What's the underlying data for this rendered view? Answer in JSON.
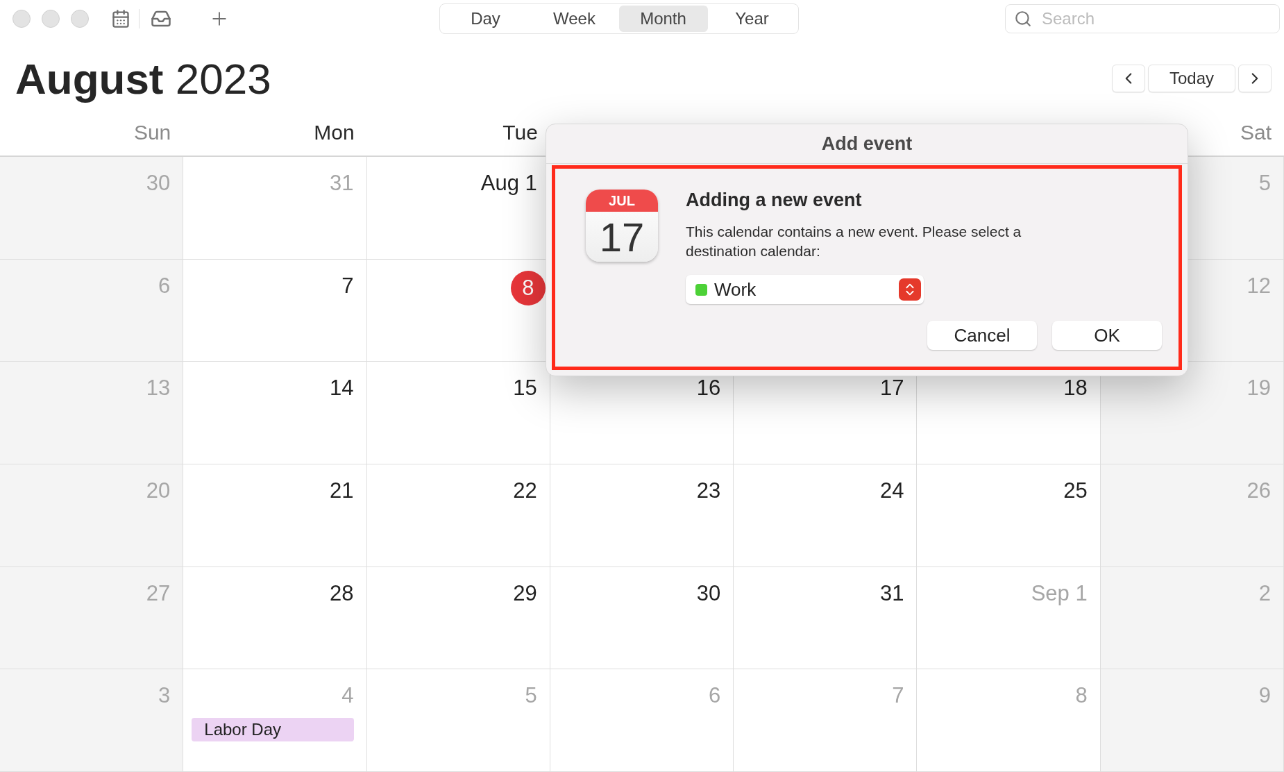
{
  "toolbar": {
    "views": [
      {
        "label": "Day",
        "selected": false
      },
      {
        "label": "Week",
        "selected": false
      },
      {
        "label": "Month",
        "selected": true
      },
      {
        "label": "Year",
        "selected": false
      }
    ],
    "search": {
      "placeholder": "Search"
    }
  },
  "header": {
    "title": "**August** 2023",
    "today_button": "Today"
  },
  "weekdays": [
    {
      "label": "Sun",
      "muted": true
    },
    {
      "label": "Mon",
      "muted": false
    },
    {
      "label": "Tue",
      "muted": false
    },
    {
      "label": "Sat",
      "muted": true
    }
  ],
  "weeks": [
    [
      {
        "date": "30",
        "muted": true
      },
      {
        "date": "31",
        "muted": true
      },
      {
        "date": "Aug 1",
        "muted": false
      },
      {
        "date": "5",
        "muted": true
      }
    ],
    [
      {
        "date": "6",
        "muted": true
      },
      {
        "date": "7",
        "muted": false
      },
      {
        "date": "8",
        "muted": false,
        "today": true
      },
      {
        "date": "12",
        "muted": true
      }
    ],
    [
      {
        "date": "13",
        "muted": true
      },
      {
        "date": "14",
        "muted": false
      },
      {
        "date": "15",
        "muted": false
      },
      {
        "date": "16",
        "muted": false
      },
      {
        "date": "17",
        "muted": false
      },
      {
        "date": "18",
        "muted": false
      },
      {
        "date": "19",
        "muted": true
      }
    ],
    [
      {
        "date": "20",
        "muted": true
      },
      {
        "date": "21",
        "muted": false
      },
      {
        "date": "22",
        "muted": false
      },
      {
        "date": "23",
        "muted": false
      },
      {
        "date": "24",
        "muted": false
      },
      {
        "date": "25",
        "muted": false
      },
      {
        "date": "26",
        "muted": true
      }
    ],
    [
      {
        "date": "27",
        "muted": true
      },
      {
        "date": "28",
        "muted": false
      },
      {
        "date": "29",
        "muted": false
      },
      {
        "date": "30",
        "muted": false
      },
      {
        "date": "31",
        "muted": false
      },
      {
        "date": "Sep 1",
        "muted": true
      },
      {
        "date": "2",
        "muted": true
      }
    ],
    [
      {
        "date": "3",
        "muted": true
      },
      {
        "date": "4",
        "muted": true,
        "events": [
          {
            "title": "Labor Day",
            "color": "#ecd3f3"
          }
        ]
      },
      {
        "date": "5",
        "muted": true
      },
      {
        "date": "6",
        "muted": true
      },
      {
        "date": "7",
        "muted": true
      },
      {
        "date": "8",
        "muted": true
      },
      {
        "date": "9",
        "muted": true
      }
    ]
  ],
  "dialog": {
    "title": "Add event",
    "icon_month": "JUL",
    "icon_day": "17",
    "heading": "Adding a new event",
    "message": "This calendar contains a new event. Please select a destination calendar:",
    "calendar": {
      "label": "Work",
      "color": "#4cd137"
    },
    "buttons": [
      "Cancel",
      "OK"
    ]
  }
}
